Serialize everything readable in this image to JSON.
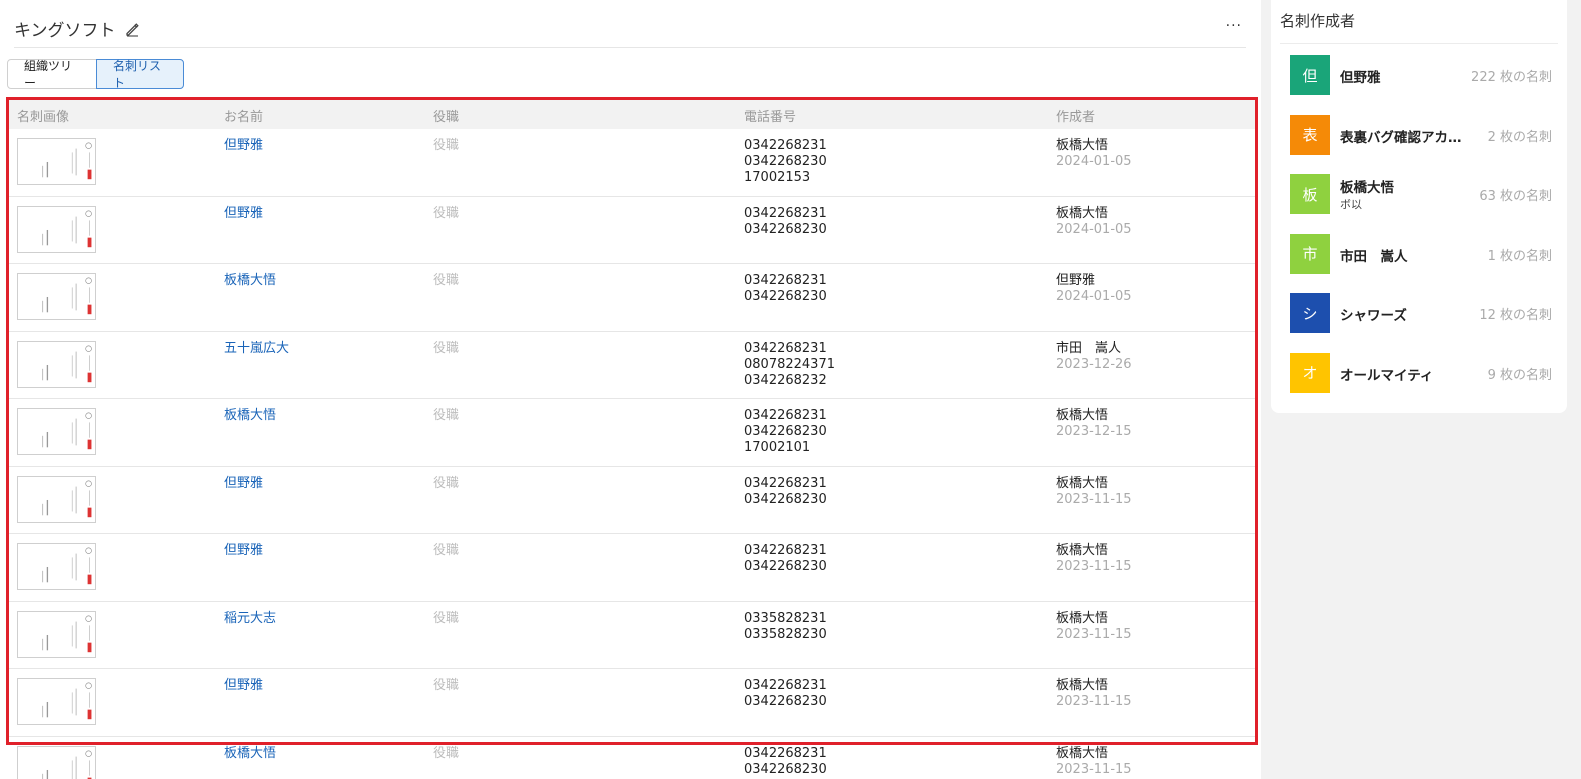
{
  "header": {
    "title": "キングソフト",
    "more": "···"
  },
  "tabs": [
    {
      "label": "組織ツリー",
      "active": false
    },
    {
      "label": "名刺リスト",
      "active": true
    }
  ],
  "table": {
    "columns": [
      "名刺画像",
      "お名前",
      "役職",
      "電話番号",
      "作成者"
    ],
    "rows": [
      {
        "name": "但野雅",
        "role": "役職",
        "phones": [
          "0342268231",
          "0342268230",
          "17002153"
        ],
        "creator": "板橋大悟",
        "date": "2024-01-05"
      },
      {
        "name": "但野雅",
        "role": "役職",
        "phones": [
          "0342268231",
          "0342268230"
        ],
        "creator": "板橋大悟",
        "date": "2024-01-05"
      },
      {
        "name": "板橋大悟",
        "role": "役職",
        "phones": [
          "0342268231",
          "0342268230"
        ],
        "creator": "但野雅",
        "date": "2024-01-05"
      },
      {
        "name": "五十嵐広大",
        "role": "役職",
        "phones": [
          "0342268231",
          "08078224371",
          "0342268232"
        ],
        "creator": "市田　嵩人",
        "date": "2023-12-26"
      },
      {
        "name": "板橋大悟",
        "role": "役職",
        "phones": [
          "0342268231",
          "0342268230",
          "17002101"
        ],
        "creator": "板橋大悟",
        "date": "2023-12-15"
      },
      {
        "name": "但野雅",
        "role": "役職",
        "phones": [
          "0342268231",
          "0342268230"
        ],
        "creator": "板橋大悟",
        "date": "2023-11-15"
      },
      {
        "name": "但野雅",
        "role": "役職",
        "phones": [
          "0342268231",
          "0342268230"
        ],
        "creator": "板橋大悟",
        "date": "2023-11-15"
      },
      {
        "name": "稲元大志",
        "role": "役職",
        "phones": [
          "0335828231",
          "0335828230"
        ],
        "creator": "板橋大悟",
        "date": "2023-11-15"
      },
      {
        "name": "但野雅",
        "role": "役職",
        "phones": [
          "0342268231",
          "0342268230"
        ],
        "creator": "板橋大悟",
        "date": "2023-11-15"
      },
      {
        "name": "板橋大悟",
        "role": "役職",
        "phones": [
          "0342268231",
          "0342268230"
        ],
        "creator": "板橋大悟",
        "date": "2023-11-15"
      }
    ]
  },
  "sidebar": {
    "title": "名刺作成者",
    "items": [
      {
        "avatar": "但",
        "color": "#1aa579",
        "name": "但野雅",
        "sub": "",
        "count": "222 枚の名刺"
      },
      {
        "avatar": "表",
        "color": "#f58a07",
        "name": "表裏バグ確認アカ…",
        "sub": "",
        "count": "2 枚の名刺"
      },
      {
        "avatar": "板",
        "color": "#8fd13f",
        "name": "板橋大悟",
        "sub": "ボ以",
        "count": "63 枚の名刺"
      },
      {
        "avatar": "市",
        "color": "#8fd13f",
        "name": "市田　嵩人",
        "sub": "",
        "count": "1 枚の名刺"
      },
      {
        "avatar": "シ",
        "color": "#1d4fae",
        "name": "シャワーズ",
        "sub": "",
        "count": "12 枚の名刺"
      },
      {
        "avatar": "オ",
        "color": "#ffc400",
        "name": "オールマイティ",
        "sub": "",
        "count": "9 枚の名刺"
      }
    ]
  }
}
